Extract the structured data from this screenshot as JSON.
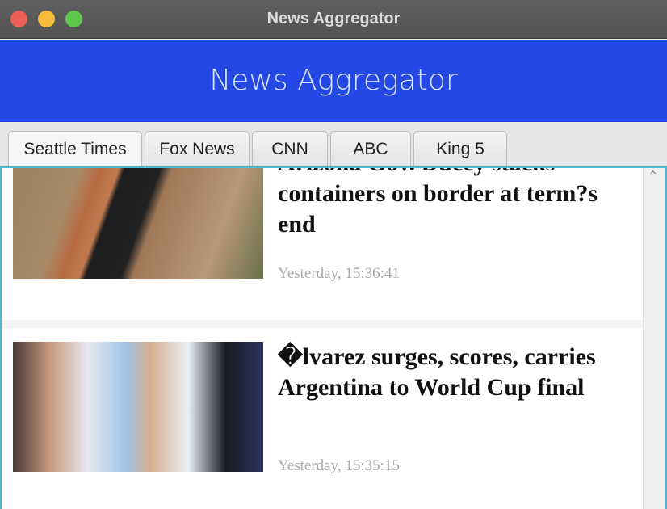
{
  "window": {
    "title": "News Aggregator",
    "controls": {
      "close": "#ee5f57",
      "minimize": "#f6bd3b",
      "zoom": "#5fc84c"
    }
  },
  "header": {
    "title": "News Aggregator",
    "color": "#2448e3"
  },
  "tabs": [
    {
      "label": "Seattle Times",
      "selected": true
    },
    {
      "label": "Fox News"
    },
    {
      "label": "CNN"
    },
    {
      "label": "ABC"
    },
    {
      "label": "King 5"
    }
  ],
  "articles": [
    {
      "title": "Arizona Gov. Ducey stacks containers on border at term?s end",
      "timestamp": "Yesterday, 15:36:41",
      "image": "border-containers-photo"
    },
    {
      "title": "�lvarez surges, scores, carries Argentina to World Cup final",
      "timestamp": "Yesterday, 15:35:15",
      "image": "soccer-players-photo"
    }
  ]
}
